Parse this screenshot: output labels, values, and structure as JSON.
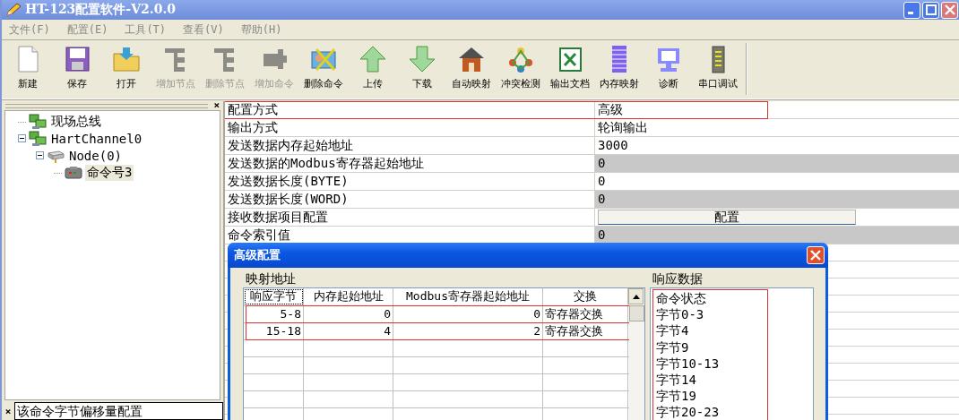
{
  "window": {
    "title": "HT-123配置软件-V2.0.0"
  },
  "menu": [
    "文件(F)",
    "配置(E)",
    "工具(T)",
    "查看(V)",
    "帮助(H)"
  ],
  "toolbar": [
    {
      "label": "新建",
      "disabled": false
    },
    {
      "label": "保存",
      "disabled": false
    },
    {
      "label": "打开",
      "disabled": false
    },
    {
      "label": "增加节点",
      "disabled": true
    },
    {
      "label": "删除节点",
      "disabled": true
    },
    {
      "label": "增加命令",
      "disabled": true
    },
    {
      "label": "删除命令",
      "disabled": false
    },
    {
      "label": "上传",
      "disabled": false
    },
    {
      "label": "下载",
      "disabled": false
    },
    {
      "label": "自动映射",
      "disabled": false
    },
    {
      "label": "冲突检测",
      "disabled": false
    },
    {
      "label": "输出文档",
      "disabled": false
    },
    {
      "label": "内存映射",
      "disabled": false
    },
    {
      "label": "诊断",
      "disabled": false
    },
    {
      "label": "串口调试",
      "disabled": false
    }
  ],
  "tree_panel": {
    "close": "×",
    "items": [
      {
        "label": "现场总线",
        "kind": "bus",
        "selected": false
      },
      {
        "label": "HartChannel0",
        "kind": "bus",
        "selected": false,
        "expanded": true,
        "children": [
          {
            "label": "Node(0)",
            "kind": "node",
            "selected": false,
            "expanded": true,
            "children": [
              {
                "label": "命令号3",
                "kind": "command",
                "selected": true
              }
            ]
          }
        ]
      }
    ]
  },
  "properties": [
    {
      "name": "配置方式",
      "value": "高级",
      "kind": "text",
      "disabled": false,
      "annotated": true
    },
    {
      "name": "输出方式",
      "value": "轮询输出",
      "kind": "text",
      "disabled": false,
      "annotated": false
    },
    {
      "name": "发送数据内存起始地址",
      "value": "3000",
      "kind": "text",
      "disabled": false,
      "annotated": false
    },
    {
      "name": "发送数据的Modbus寄存器起始地址",
      "value": "0",
      "kind": "text",
      "disabled": true,
      "annotated": false
    },
    {
      "name": "发送数据长度(BYTE)",
      "value": "0",
      "kind": "text",
      "disabled": false,
      "annotated": false
    },
    {
      "name": "发送数据长度(WORD)",
      "value": "0",
      "kind": "text",
      "disabled": true,
      "annotated": false
    },
    {
      "name": "接收数据项目配置",
      "value": "配置",
      "kind": "button",
      "disabled": false,
      "annotated": false
    },
    {
      "name": "命令索引值",
      "value": "0",
      "kind": "text",
      "disabled": true,
      "annotated": false
    }
  ],
  "dialog": {
    "title": "高级配置",
    "mapping_label": "映射地址",
    "columns": [
      "响应字节",
      "内存起始地址",
      "Modbus寄存器起始地址",
      "交换"
    ],
    "rows": [
      {
        "cells": [
          "5-8",
          "0",
          "0",
          "寄存器交换"
        ],
        "annotated": true
      },
      {
        "cells": [
          "15-18",
          "4",
          "2",
          "寄存器交换"
        ],
        "annotated": true
      }
    ],
    "response_label": "响应数据",
    "response_annotated": true,
    "response_items": [
      "命令状态",
      "字节0-3",
      "字节4",
      "字节9",
      "字节10-13",
      "字节14",
      "字节19",
      "字节20-23"
    ]
  },
  "status_bar": {
    "close": "×",
    "text": "该命令字节偏移量配置"
  }
}
